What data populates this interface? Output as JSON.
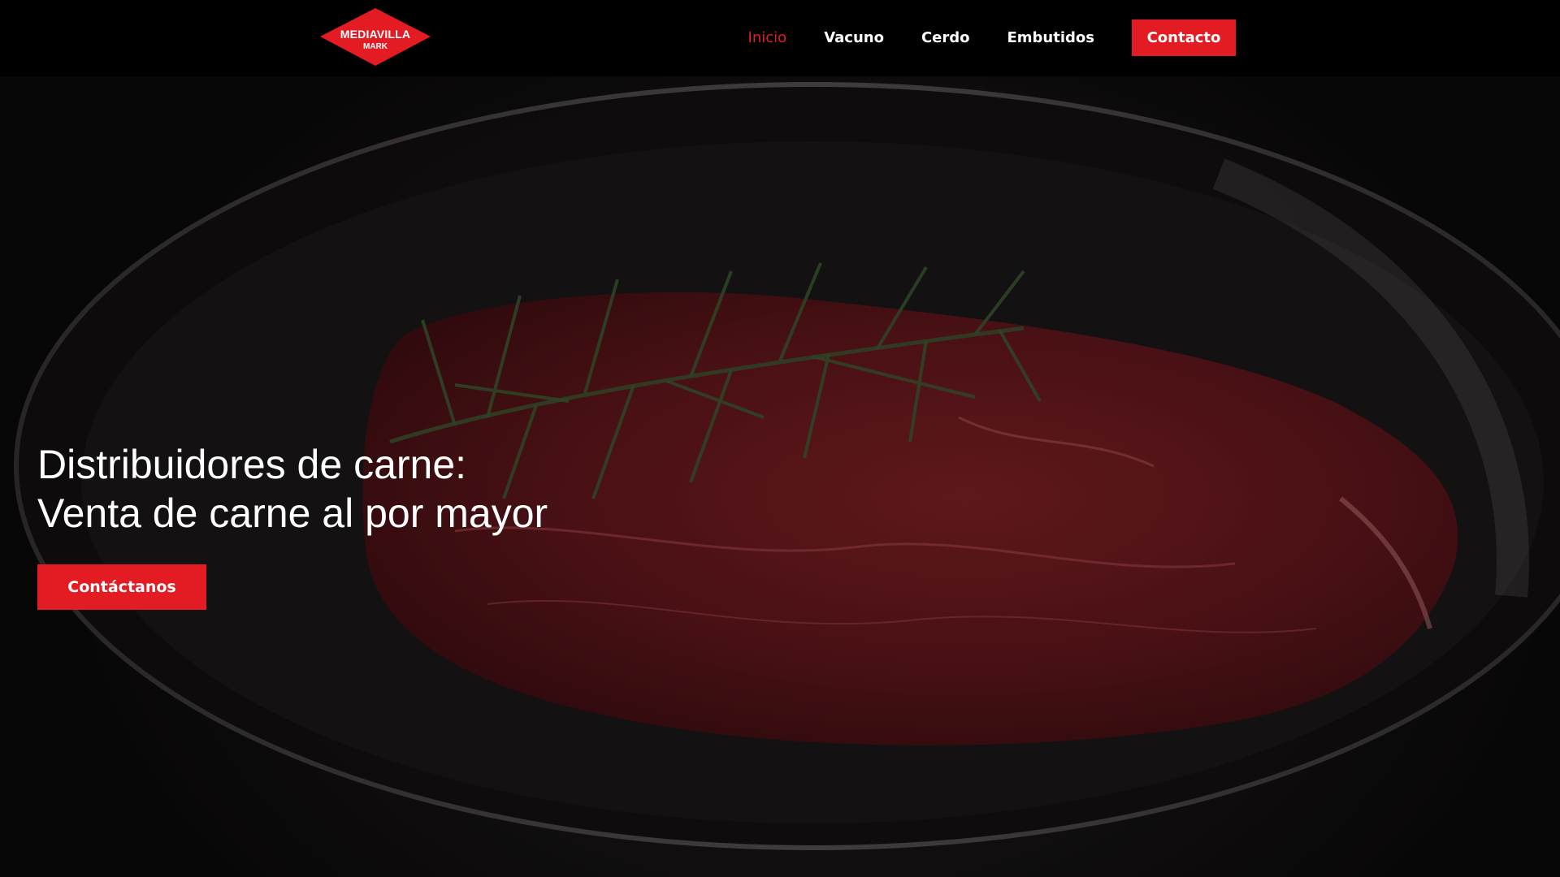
{
  "brand": {
    "name": "MEDIAVILLA",
    "sub": "MARK",
    "color": "#e31b23"
  },
  "nav": {
    "items": [
      {
        "label": "Inicio",
        "active": true
      },
      {
        "label": "Vacuno",
        "active": false
      },
      {
        "label": "Cerdo",
        "active": false
      },
      {
        "label": "Embutidos",
        "active": false
      }
    ],
    "contact_label": "Contacto"
  },
  "hero": {
    "title_line1": "Distribuidores de carne:",
    "title_line2": "Venta de carne al por mayor",
    "button_label": "Contáctanos"
  }
}
